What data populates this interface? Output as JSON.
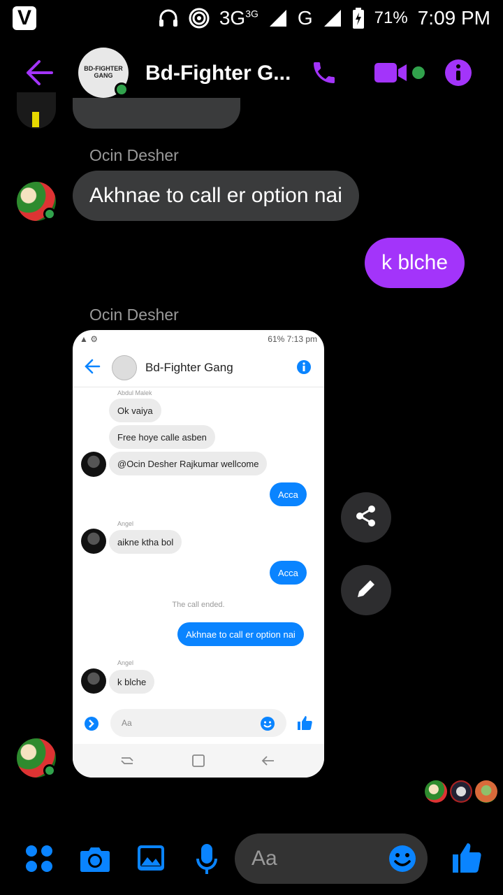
{
  "status_bar": {
    "carrier_logo": "V",
    "network_1": "3G",
    "network_1_sup": "3G",
    "network_2": "G",
    "battery": "71%",
    "time": "7:09 PM"
  },
  "header": {
    "title": "Bd-Fighter G...",
    "group_avatar_text": "BD-FIGHTER GANG",
    "accent_color": "#a334fa"
  },
  "messages": [
    {
      "sender": "Ocin Desher",
      "text": "Akhnae to call er option nai",
      "direction": "incoming"
    },
    {
      "text": "k blche",
      "direction": "outgoing"
    },
    {
      "sender": "Ocin Desher",
      "type": "image",
      "direction": "incoming"
    }
  ],
  "shared_screenshot": {
    "status_right": "61% 7:13 pm",
    "title": "Bd-Fighter Gang",
    "items": [
      {
        "sender": "Abdul Malek",
        "text": "Ok vaiya",
        "direction": "in"
      },
      {
        "text": "Free hoye calle asben",
        "direction": "in"
      },
      {
        "text": "@Ocin Desher Rajkumar  wellcome",
        "direction": "in"
      },
      {
        "text": "Acca",
        "direction": "out"
      },
      {
        "sender": "Angel",
        "text": "aikne ktha bol",
        "direction": "in"
      },
      {
        "text": "Acca",
        "direction": "out"
      },
      {
        "system": "The call ended."
      },
      {
        "text": "Akhnae to call er option nai",
        "direction": "out"
      },
      {
        "sender": "Angel",
        "text": "k blche",
        "direction": "in"
      }
    ],
    "composer_placeholder": "Aa"
  },
  "composer": {
    "placeholder": "Aa"
  }
}
